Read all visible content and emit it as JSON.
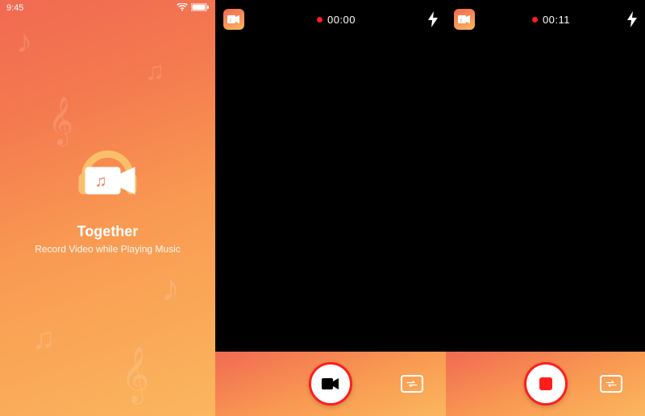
{
  "splash": {
    "status_time": "9:45",
    "title": "Together",
    "subtitle": "Record Video while Playing Music",
    "icon_names": {
      "wifi": "wifi-icon",
      "battery": "battery-icon",
      "logo": "app-logo"
    }
  },
  "panel_idle": {
    "rec_time": "00:00",
    "icons": {
      "app": "app-icon",
      "flash": "flash-icon",
      "main": "record-button",
      "flip": "flip-camera-button"
    }
  },
  "panel_recording": {
    "rec_time": "00:11",
    "icons": {
      "app": "app-icon",
      "flash": "flash-icon",
      "main": "stop-button",
      "flip": "flip-camera-button"
    }
  },
  "colors": {
    "accent_gradient_start": "#f16a52",
    "accent_gradient_end": "#fbb65e",
    "record_red": "#ff1d1d"
  }
}
